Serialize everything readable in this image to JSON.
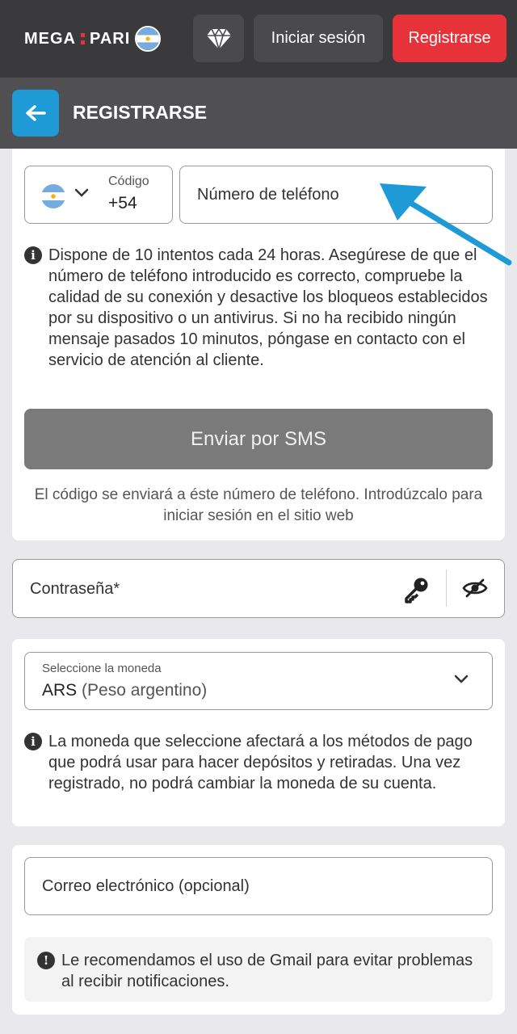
{
  "header": {
    "logo_text_left": "MEGA",
    "logo_text_right": "PARI",
    "gem_icon": "diamond-icon",
    "login_label": "Iniciar sesión",
    "register_label": "Registrarse",
    "colors": {
      "bar": "#3a3a3c",
      "register": "#e8323a"
    }
  },
  "titlebar": {
    "back_icon": "arrow-left-icon",
    "title": "REGISTRARSE",
    "back_color": "#1e9bd7"
  },
  "phone": {
    "code_label": "Código",
    "code_value": "+54",
    "phone_placeholder": "Número de teléfono",
    "info_text": "Dispone de 10 intentos cada 24 horas. Asegúrese de que el número de teléfono introducido es correcto, compruebe la calidad de su conexión y desactive los bloqueos establecidos por su dispositivo o un antivirus. Si no ha recibido ningún mensaje pasados 10 minutos, póngase en contacto con el servicio de atención al cliente.",
    "sms_button": "Enviar por SMS",
    "sms_note": "El código se enviará a éste número de teléfono. Introdúzcalo para iniciar sesión en el sitio web"
  },
  "password": {
    "placeholder": "Contraseña*",
    "key_icon": "key-icon",
    "eye_icon": "eye-hidden-icon"
  },
  "currency": {
    "label": "Seleccione la moneda",
    "value_code": "ARS",
    "value_name": "(Peso argentino)",
    "info_text": "La moneda que seleccione afectará a los métodos de pago que podrá usar para hacer depósitos y retiradas. Una vez registrado, no podrá cambiar la moneda de su cuenta."
  },
  "email": {
    "placeholder": "Correo electrónico (opcional)",
    "note": "Le recomendamos el uso de Gmail para evitar problemas al recibir notificaciones."
  }
}
